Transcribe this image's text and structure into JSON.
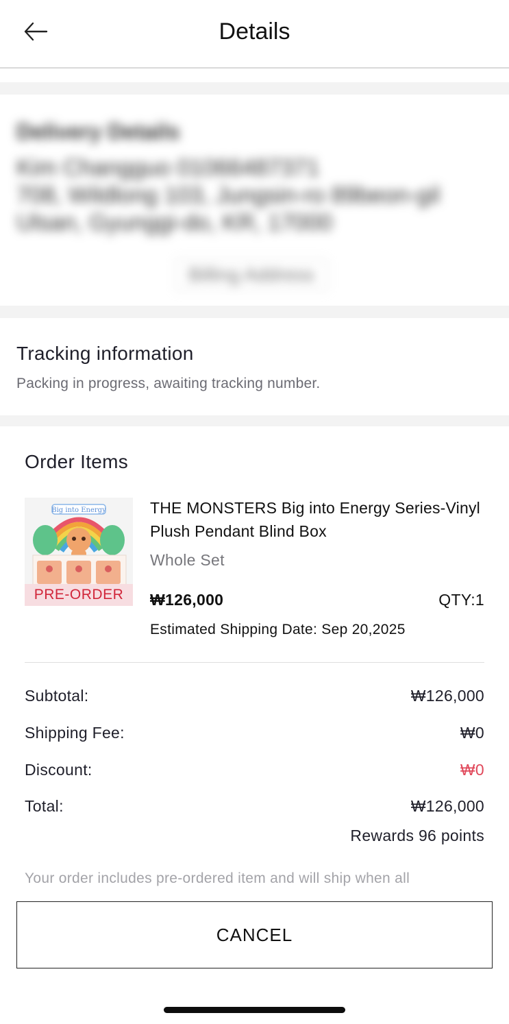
{
  "header": {
    "title": "Details"
  },
  "delivery": {
    "title": "Delivery Details",
    "lines": [
      "Kim Changguo 01066487371",
      "708, Wildlong 103, Jungsin-ro 89beon-gil",
      "Ulsan, Gyunggi-do, KR, 17000"
    ],
    "billing_button": "Billing Address"
  },
  "tracking": {
    "title": "Tracking information",
    "status": "Packing in progress, awaiting tracking number."
  },
  "order": {
    "title": "Order Items",
    "item": {
      "name": "THE MONSTERS Big into Energy Series-Vinyl Plush Pendant Blind Box",
      "variant": "Whole Set",
      "tag": "PRE-ORDER",
      "price": "₩126,000",
      "qty": "QTY:1",
      "shipping_date": "Estimated Shipping Date: Sep 20,2025",
      "image_text": "Big into Energy"
    },
    "summary": {
      "subtotal_label": "Subtotal:",
      "subtotal_value": "₩126,000",
      "shipping_label": "Shipping Fee:",
      "shipping_value": "₩0",
      "discount_label": "Discount:",
      "discount_value": "₩0",
      "total_label": "Total:",
      "total_value": "₩126,000",
      "rewards": "Rewards 96 points"
    },
    "note": "Your order includes pre-ordered item and will ship when all"
  },
  "actions": {
    "cancel_label": "CANCEL"
  },
  "colors": {
    "accent_red": "#e0485a",
    "preorder_bg": "#f7dde1",
    "preorder_text": "#d1263a",
    "section_gap": "#f3f3f3"
  },
  "icons": {
    "back": "arrow-left-icon"
  }
}
